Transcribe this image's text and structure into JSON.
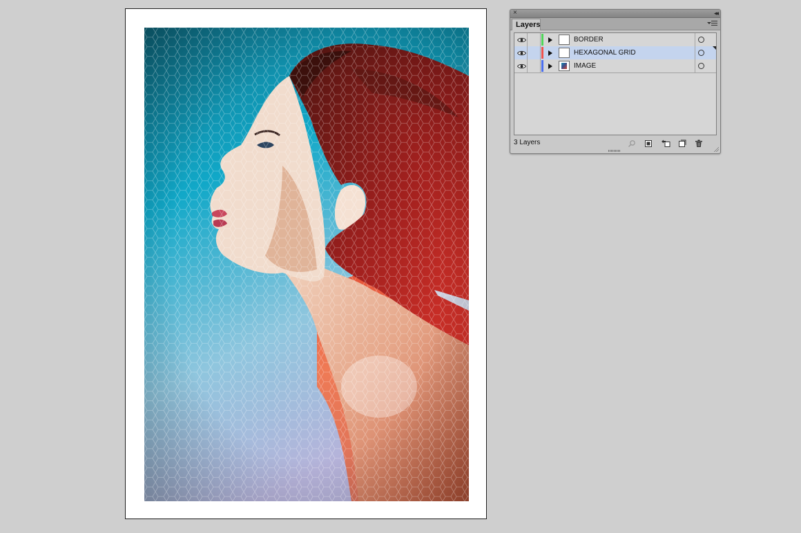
{
  "app": {
    "panel_title": "Layers",
    "window_controls": {
      "close": "×",
      "collapse": "◂◂"
    }
  },
  "layers": [
    {
      "name": "BORDER",
      "visible": true,
      "color": "#4fd65a",
      "thumbnail": "blank",
      "selected": false
    },
    {
      "name": "HEXAGONAL GRID",
      "visible": true,
      "color": "#f0524a",
      "thumbnail": "blank",
      "selected": true
    },
    {
      "name": "IMAGE",
      "visible": true,
      "color": "#4b6ff0",
      "thumbnail": "image",
      "selected": false
    }
  ],
  "footer": {
    "layer_count": "3 Layers",
    "icons": [
      "locate-object-icon",
      "make-clipping-mask-icon",
      "new-sublayer-icon",
      "new-layer-icon",
      "delete-layer-icon"
    ]
  },
  "colors": {
    "workspace": "#cfcfcf",
    "selection": "#c4d4ee",
    "panel": "#c9c9c9"
  }
}
